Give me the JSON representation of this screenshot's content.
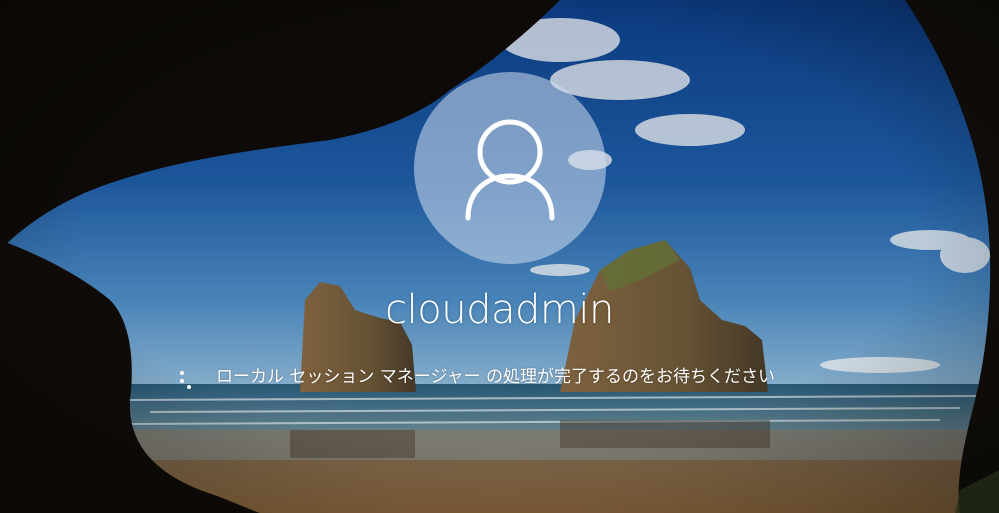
{
  "user": {
    "name": "cloudadmin",
    "avatar_icon": "user-silhouette-icon"
  },
  "status": {
    "spinner_icon": "loading-spinner-icon",
    "message": "ローカル セッション マネージャー の処理が完了するのをお待ちください"
  },
  "background": {
    "scene": "sea-cave-beach-wallpaper",
    "sky_color": "#1f5ea8",
    "sea_color": "#2f6f8f",
    "sand_color": "#8a6a44",
    "rock_color": "#0f0b08"
  }
}
